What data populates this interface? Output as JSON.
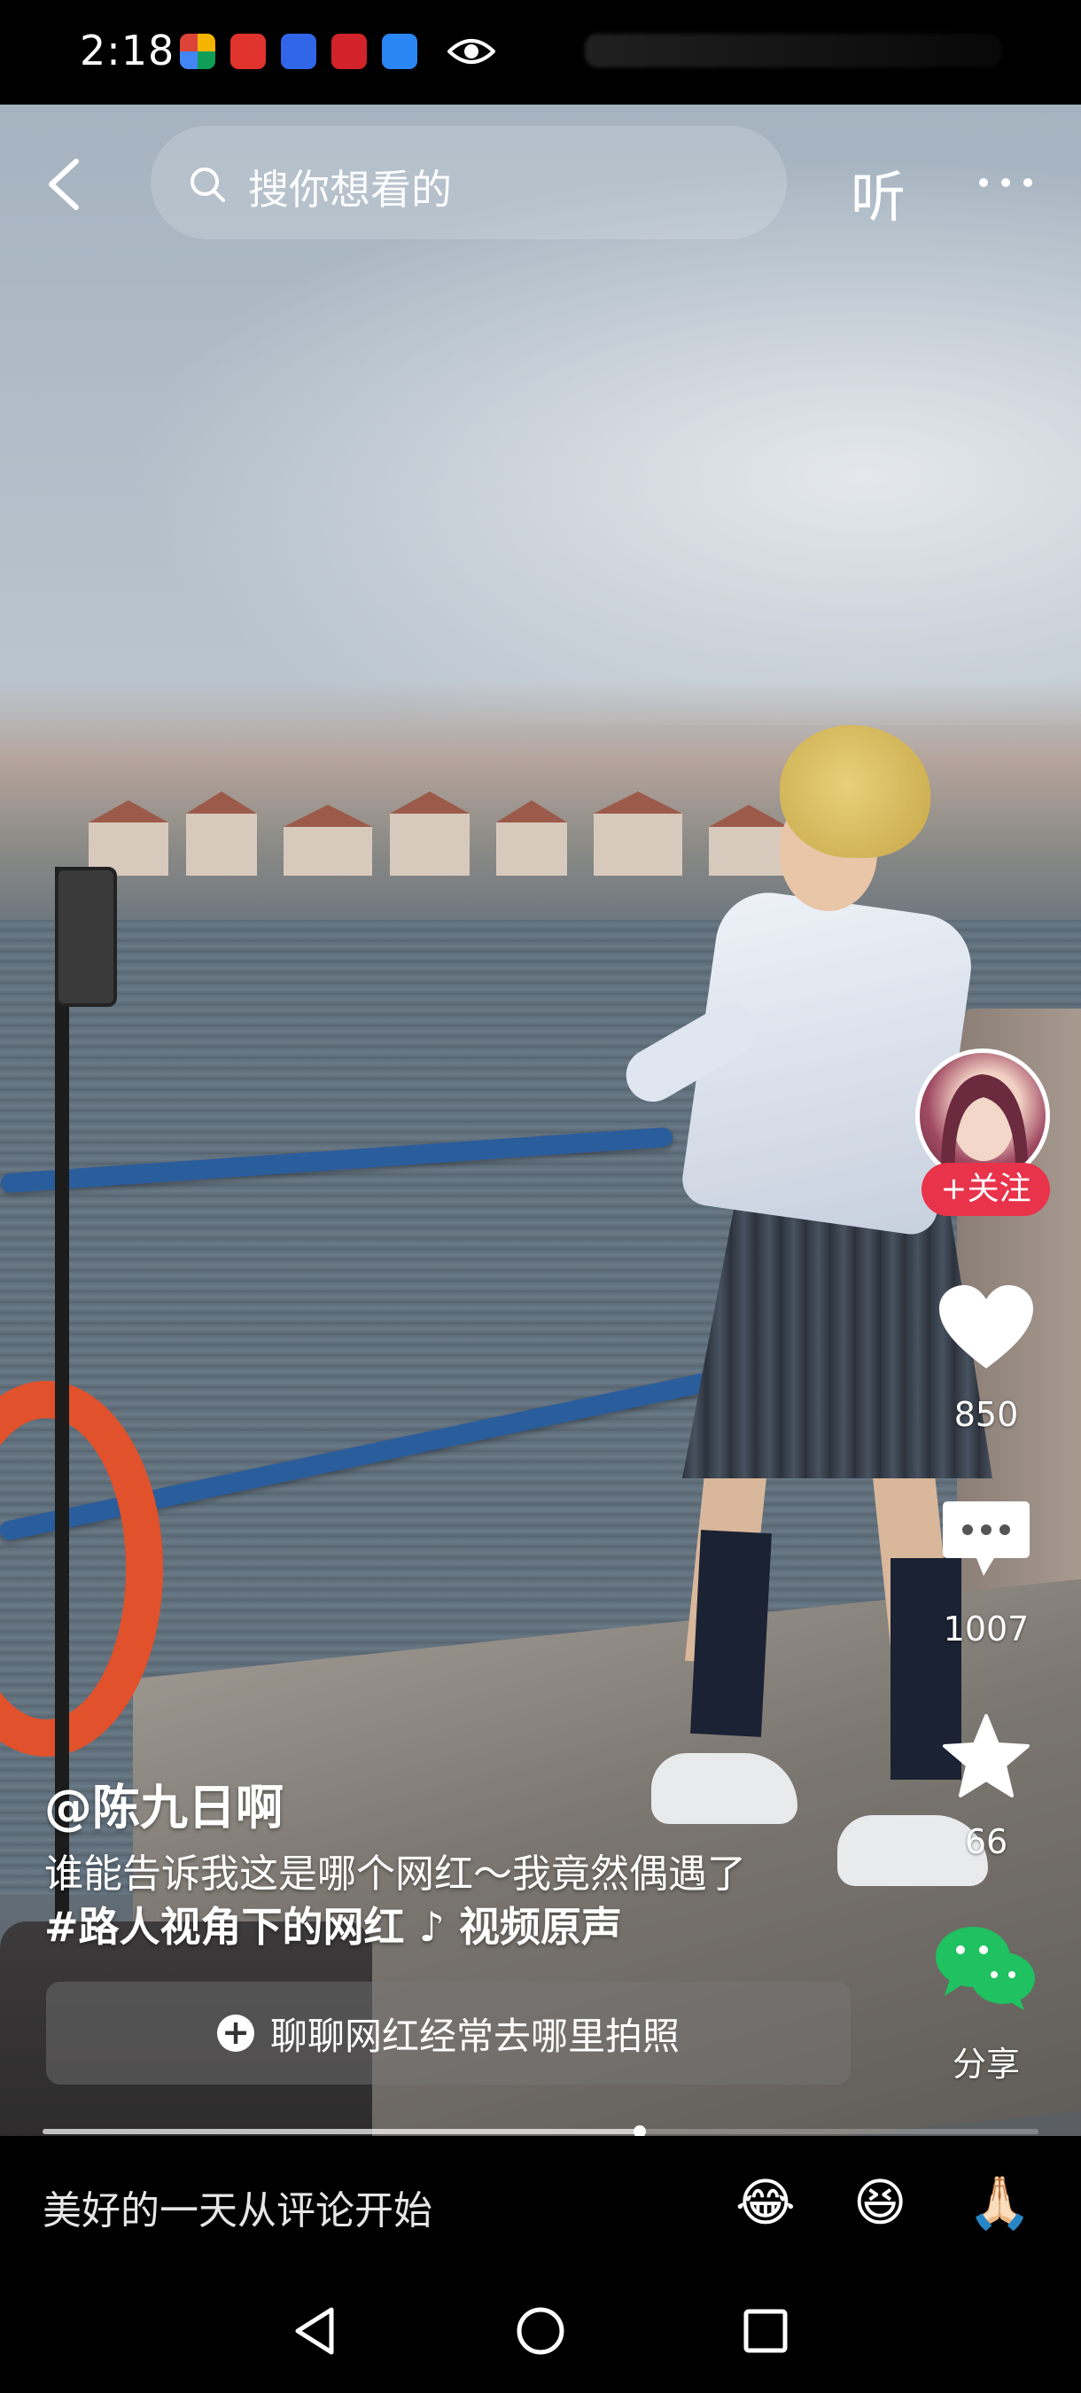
{
  "status_bar": {
    "time": "2:18"
  },
  "top_bar": {
    "search_placeholder": "搜你想看的",
    "listen_label": "听"
  },
  "author": {
    "follow_label": "+关注"
  },
  "actions": {
    "likes": "850",
    "comments": "1007",
    "favorites": "66",
    "share_label": "分享"
  },
  "caption": {
    "author_name": "@陈九日啊",
    "description": "谁能告诉我这是哪个网红～我竟然偶遇了",
    "hashtag": "#路人视角下的网红",
    "music": "♪ 视频原声",
    "topic_prompt": "聊聊网红经常去哪里拍照"
  },
  "playback": {
    "progress": 0.6
  },
  "comment_bar": {
    "placeholder": "美好的一天从评论开始",
    "emojis": [
      "😂",
      "😆",
      "🙏🏻"
    ]
  },
  "colors": {
    "follow_red": "#e8334a",
    "share_green": "#1fc160"
  }
}
